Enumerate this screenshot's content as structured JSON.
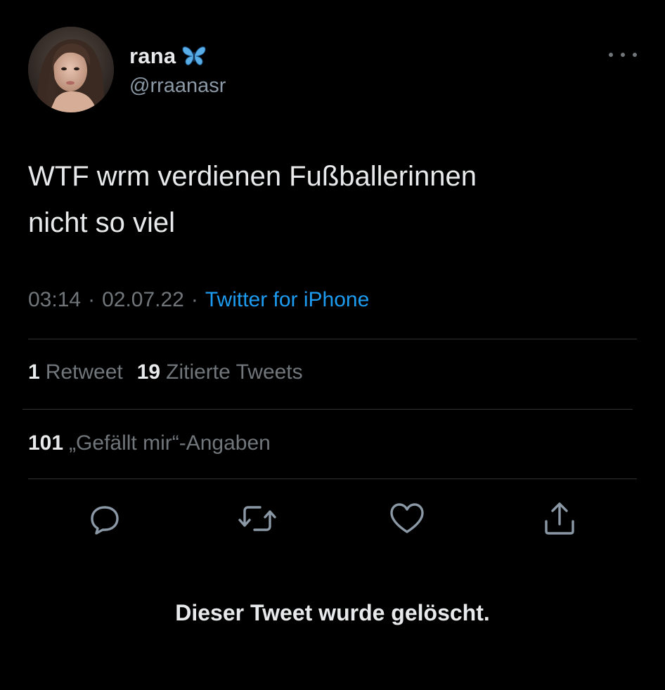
{
  "tweet": {
    "author": {
      "display_name": "rana",
      "badge_icon": "butterfly-emoji-icon",
      "handle": "@rraanasr"
    },
    "text": "WTF wrm verdienen Fußballerinnen\nnicht so viel",
    "time": "03:14",
    "date": "02.07.22",
    "separator": "·",
    "source": "Twitter for iPhone",
    "stats": {
      "retweets_count": "1",
      "retweets_label": "Retweet",
      "quotes_count": "19",
      "quotes_label": "Zitierte Tweets",
      "likes_count": "101",
      "likes_label": "„Gefällt mir“-Angaben"
    },
    "actions": [
      "reply-icon",
      "retweet-icon",
      "like-icon",
      "share-icon"
    ],
    "deleted_notice": "Dieser Tweet wurde gelöscht."
  },
  "colors": {
    "background": "#000000",
    "primary_text": "#e7e9ea",
    "secondary_text": "#71767b",
    "link": "#1d9bf0",
    "divider": "#2f3336",
    "butterfly": "#5aaee8"
  }
}
